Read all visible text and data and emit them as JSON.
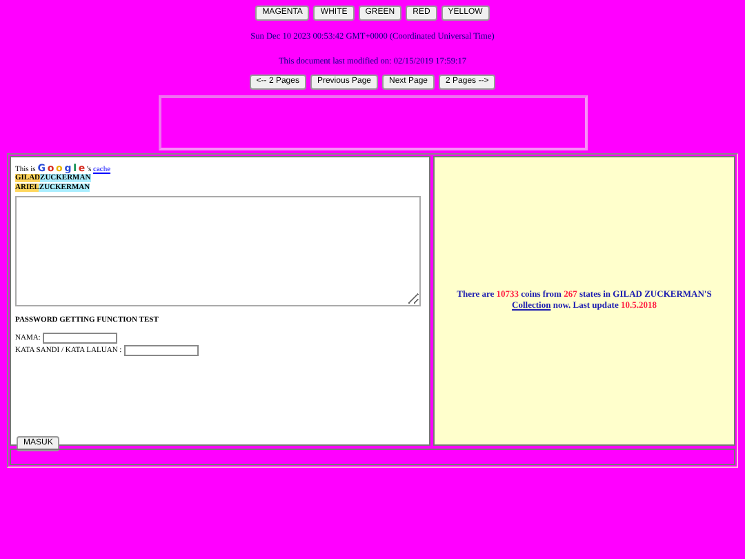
{
  "color_buttons": [
    "MAGENTA",
    "WHITE",
    "GREEN",
    "RED",
    "YELLOW"
  ],
  "date_line": "Sun Dec 10 2023 00:53:42 GMT+0000 (Coordinated Universal Time)",
  "modified_line": "This document last modified on: 02/15/2019 17:59:17",
  "nav_buttons": [
    "<-- 2 Pages",
    "Previous Page",
    "Next Page",
    "2 Pages -->"
  ],
  "cache_note": {
    "prefix": "This is ",
    "letters": [
      {
        "text": "G",
        "color": "#2a4bd7"
      },
      {
        "text": "o",
        "color": "#d62d20"
      },
      {
        "text": "o",
        "color": "#e8b400"
      },
      {
        "text": "g",
        "color": "#2a4bd7"
      },
      {
        "text": "l",
        "color": "#008744"
      },
      {
        "text": "e",
        "color": "#d62d20"
      }
    ],
    "suffix": "'s ",
    "link": "cache"
  },
  "names": [
    {
      "first": "GILAD",
      "last": "ZUCKERMAN"
    },
    {
      "first": "ARIEL",
      "last": "ZUCKERMAN"
    }
  ],
  "form": {
    "title": "PASSWORD GETTING FUNCTION TEST",
    "fields": [
      {
        "label": "NAMA:"
      },
      {
        "label": "KATA SANDI / KATA LALUAN :"
      }
    ],
    "submit": "MASUK"
  },
  "coin_info": [
    {
      "kind": "text",
      "text": "There are "
    },
    {
      "kind": "number",
      "text": "10733"
    },
    {
      "kind": "text",
      "text": " coins from "
    },
    {
      "kind": "number",
      "text": "267"
    },
    {
      "kind": "text",
      "text": " states in GILAD ZUCKERMAN'S "
    },
    {
      "kind": "link",
      "text": "Collection"
    },
    {
      "kind": "text",
      "text": " now. Last update "
    },
    {
      "kind": "number",
      "text": "10.5.2018"
    }
  ]
}
